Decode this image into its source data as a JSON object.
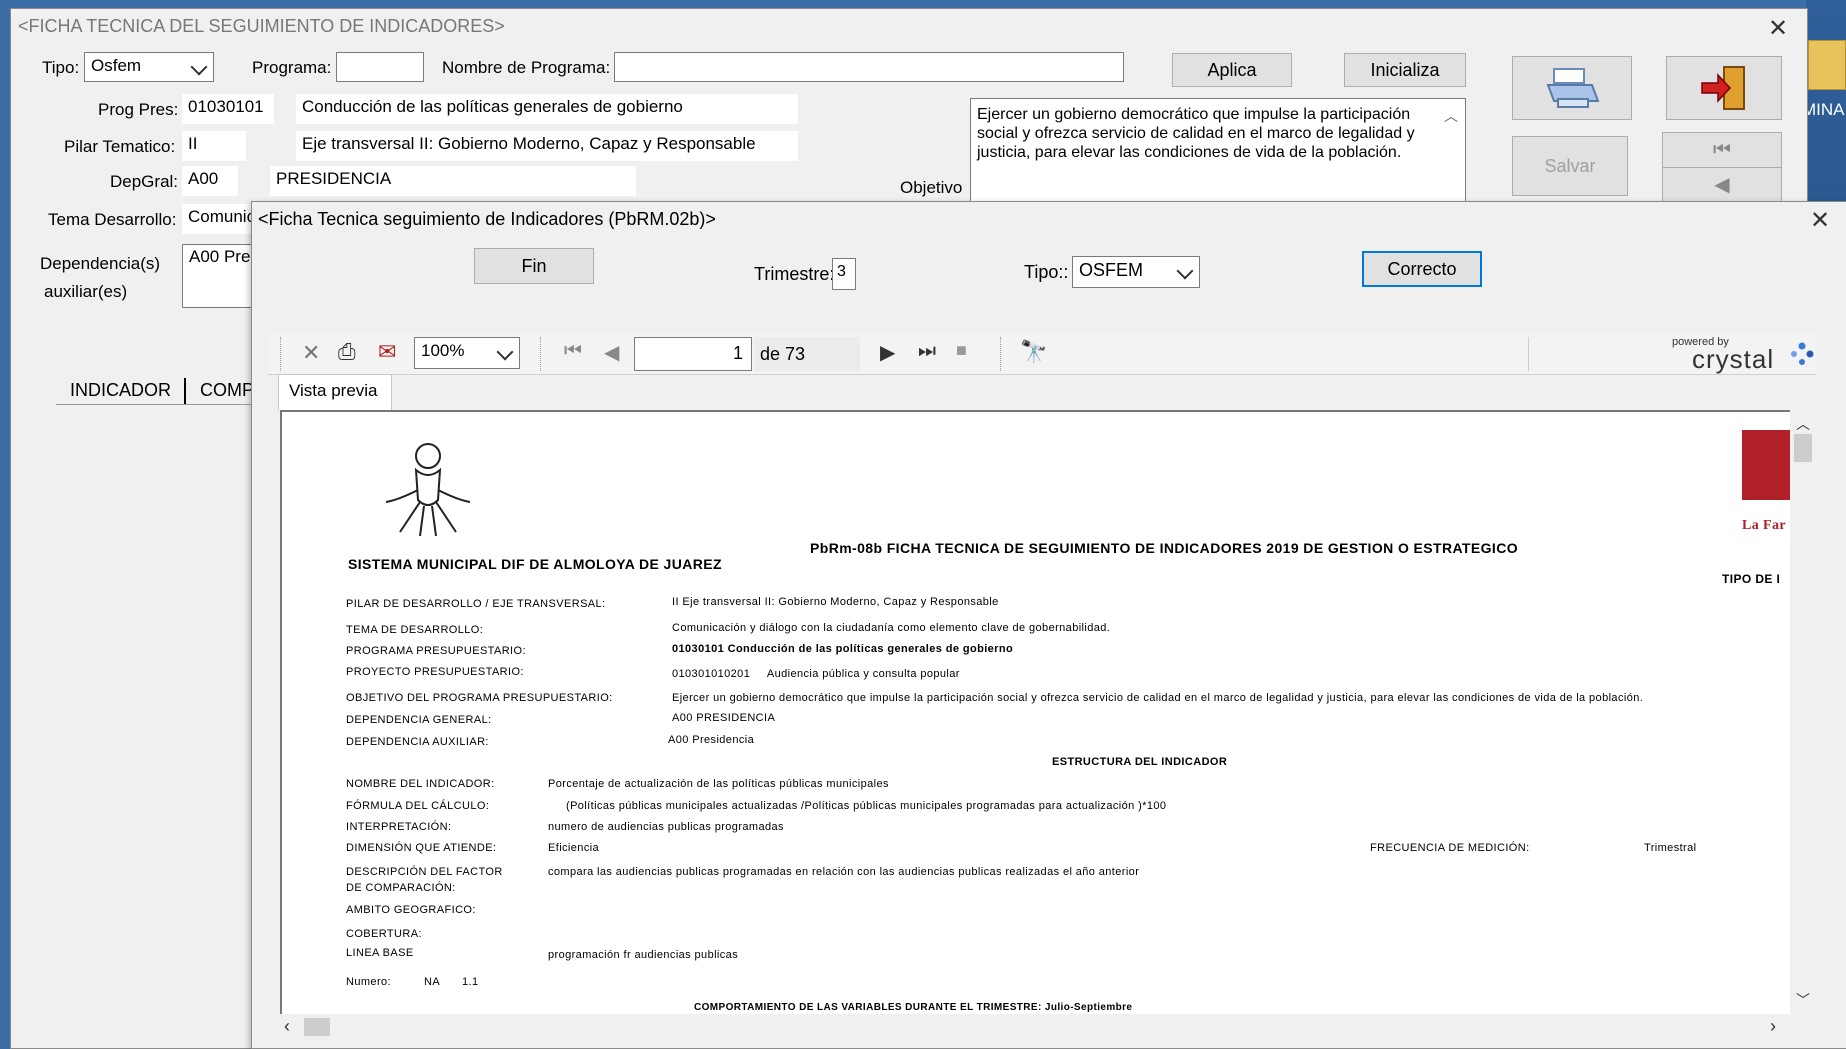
{
  "desktop": {
    "folder_label": "MINA"
  },
  "main_window": {
    "title": "<FICHA TECNICA DEL SEGUIMIENTO DE INDICADORES>",
    "close": "✕",
    "tipo": {
      "label": "Tipo:",
      "value": "Osfem"
    },
    "programa": {
      "label": "Programa:",
      "value": ""
    },
    "nombre_programa": {
      "label": "Nombre de Programa:",
      "value": ""
    },
    "aplica": "Aplica",
    "inicializa": "Inicializa",
    "salvar": "Salvar",
    "prog_pres": {
      "label": "Prog Pres:",
      "code": "01030101",
      "name": "Conducción de las políticas generales de gobierno"
    },
    "pilar": {
      "label": "Pilar Tematico:",
      "code": "II",
      "name": "Eje transversal II: Gobierno Moderno, Capaz y Responsable"
    },
    "depgral": {
      "label": "DepGral:",
      "code": "A00",
      "name": "PRESIDENCIA"
    },
    "objetivo": {
      "label": "Objetivo",
      "text": "Ejercer un gobierno democrático que impulse la participación social y ofrezca servicio de calidad en el marco de legalidad y justicia, para elevar las condiciones de vida de la población."
    },
    "tema": {
      "label": "Tema Desarrollo:",
      "value": "Comunic"
    },
    "dependencia": {
      "label1": "Dependencia(s)",
      "label2": "auxiliar(es)",
      "value": "A00 Pre"
    },
    "tabs": [
      "INDICADOR",
      "COMP"
    ]
  },
  "report_window": {
    "title": "<Ficha Tecnica seguimiento de Indicadores (PbRM.02b)>",
    "close": "✕",
    "fin": "Fin",
    "trimestre": {
      "label": "Trimestre:",
      "value": "3"
    },
    "tipo": {
      "label": "Tipo::",
      "value": "OSFEM"
    },
    "correcto": "Correcto",
    "toolbar": {
      "zoom": "100%",
      "page": "1",
      "of": "de 73",
      "powered": "powered by",
      "brand": "crystal"
    },
    "preview_tab": "Vista previa"
  },
  "report": {
    "org": "SISTEMA MUNICIPAL DIF DE ALMOLOYA DE JUAREZ",
    "title": "PbRm-08b FICHA TECNICA DE SEGUIMIENTO DE INDICADORES 2019 DE GESTION O ESTRATEGICO",
    "tipo_de": "TIPO DE I",
    "logo_text": "La Far",
    "rows": [
      {
        "label": "PILAR DE DESARROLLO / EJE TRANSVERSAL:",
        "value": "II Eje transversal II: Gobierno Moderno, Capaz y Responsable"
      },
      {
        "label": "TEMA DE DESARROLLO:",
        "value": "Comunicación y diálogo con la ciudadanía como elemento clave de gobernabilidad."
      },
      {
        "label": "PROGRAMA PRESUPUESTARIO:",
        "value": "01030101 Conducción de las políticas generales de gobierno"
      },
      {
        "label": "PROYECTO PRESUPUESTARIO:",
        "value": "010301010201     Audiencia pública y consulta popular"
      },
      {
        "label": "OBJETIVO DEL PROGRAMA PRESUPUESTARIO:",
        "value": "Ejercer un gobierno democrático que impulse la participación social y ofrezca servicio de calidad en el marco de legalidad y justicia, para elevar las condiciones de vida de la población."
      },
      {
        "label": "DEPENDENCIA GENERAL:",
        "value": "A00 PRESIDENCIA"
      },
      {
        "label": "DEPENDENCIA AUXILIAR:",
        "value": "A00 Presidencia"
      }
    ],
    "estructura": "ESTRUCTURA DEL INDICADOR",
    "ind_rows": [
      {
        "label": "NOMBRE DEL INDICADOR:",
        "value": "Porcentaje de actualización de las políticas públicas municipales"
      },
      {
        "label": "FÓRMULA DEL CÁLCULO:",
        "value": "(Políticas públicas municipales actualizadas /Políticas públicas municipales programadas para actualización )*100"
      },
      {
        "label": "INTERPRETACIÓN:",
        "value": "numero de audiencias publicas programadas"
      },
      {
        "label": "DIMENSIÓN QUE ATIENDE:",
        "value": "Eficiencia"
      }
    ],
    "frecuencia": {
      "label": "FRECUENCIA DE MEDICIÓN:",
      "value": "Trimestral"
    },
    "desc_label1": "DESCRIPCIÓN DEL FACTOR",
    "desc_label2": "DE COMPARACIÓN:",
    "desc_value": "compara las audiencias publicas programadas en relación con las audiencias publicas realizadas el año anterior",
    "ambito": "AMBITO GEOGRAFICO:",
    "cobertura": "COBERTURA:",
    "linea_label": "LINEA BASE",
    "linea_value": "programación fr audiencias publicas",
    "numero": {
      "label": "Numero:",
      "v1": "NA",
      "v2": "1.1"
    },
    "comportamiento": "COMPORTAMIENTO DE LAS VARIABLES DURANTE EL TRIMESTRE: Julio-Septiembre"
  }
}
